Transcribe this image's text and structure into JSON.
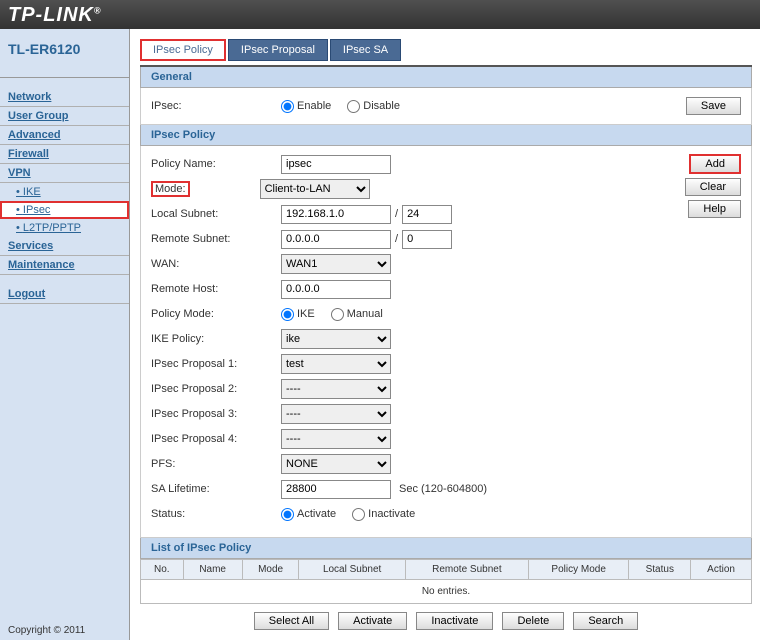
{
  "brand": "TP-LINK",
  "model": "TL-ER6120",
  "copyright": "Copyright © 2011",
  "nav": {
    "network": "Network",
    "usergroup": "User Group",
    "advanced": "Advanced",
    "firewall": "Firewall",
    "vpn": "VPN",
    "ike": "IKE",
    "ipsec": "IPsec",
    "l2tp": "L2TP/PPTP",
    "services": "Services",
    "maintenance": "Maintenance",
    "logout": "Logout"
  },
  "tabs": {
    "policy": "IPsec Policy",
    "proposal": "IPsec Proposal",
    "sa": "IPsec SA"
  },
  "sections": {
    "general": "General",
    "ipsec_policy": "IPsec Policy",
    "list": "List of IPsec Policy"
  },
  "labels": {
    "ipsec": "IPsec:",
    "enable": "Enable",
    "disable": "Disable",
    "policy_name": "Policy Name:",
    "mode": "Mode:",
    "local_subnet": "Local Subnet:",
    "remote_subnet": "Remote Subnet:",
    "wan": "WAN:",
    "remote_host": "Remote Host:",
    "policy_mode": "Policy Mode:",
    "ike_r": "IKE",
    "manual_r": "Manual",
    "ike_policy": "IKE Policy:",
    "prop1": "IPsec Proposal 1:",
    "prop2": "IPsec Proposal 2:",
    "prop3": "IPsec Proposal 3:",
    "prop4": "IPsec Proposal 4:",
    "pfs": "PFS:",
    "sa_lifetime": "SA Lifetime:",
    "sa_after": "Sec (120-604800)",
    "status": "Status:",
    "activate": "Activate",
    "inactivate": "Inactivate"
  },
  "values": {
    "policy_name": "ipsec",
    "mode": "Client-to-LAN",
    "local_subnet": "192.168.1.0",
    "local_mask": "24",
    "remote_subnet": "0.0.0.0",
    "remote_mask": "0",
    "wan": "WAN1",
    "remote_host": "0.0.0.0",
    "ike_policy": "ike",
    "prop1": "test",
    "prop2": "----",
    "prop3": "----",
    "prop4": "----",
    "pfs": "NONE",
    "sa_lifetime": "28800"
  },
  "buttons": {
    "save": "Save",
    "add": "Add",
    "clear": "Clear",
    "help": "Help",
    "select_all": "Select All",
    "activate": "Activate",
    "inactivate": "Inactivate",
    "delete": "Delete",
    "search": "Search"
  },
  "table": {
    "headers": [
      "No.",
      "Name",
      "Mode",
      "Local Subnet",
      "Remote Subnet",
      "Policy Mode",
      "Status",
      "Action"
    ],
    "empty": "No entries."
  }
}
